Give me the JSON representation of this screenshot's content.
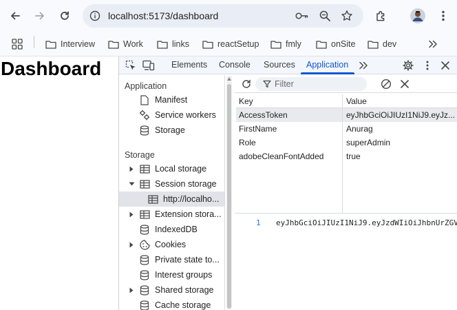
{
  "browser": {
    "url": "localhost:5173/dashboard",
    "bookmarks": [
      "Interview",
      "Work",
      "links",
      "reactSetup",
      "fmly",
      "onSite",
      "dev"
    ]
  },
  "page": {
    "heading": "Dashboard"
  },
  "devtools": {
    "tabs": [
      "Elements",
      "Console",
      "Sources",
      "Application"
    ],
    "active_tab": "Application",
    "sidebar": {
      "application_title": "Application",
      "application_items": [
        "Manifest",
        "Service workers",
        "Storage"
      ],
      "storage_title": "Storage",
      "storage_items": [
        "Local storage",
        "Session storage",
        "http://localho...",
        "Extension stora...",
        "IndexedDB",
        "Cookies",
        "Private state to...",
        "Interest groups",
        "Shared storage",
        "Cache storage"
      ]
    },
    "filter_placeholder": "Filter",
    "table": {
      "headers": [
        "Key",
        "Value"
      ],
      "rows": [
        {
          "key": "AccessToken",
          "value": "eyJhbGciOiJIUzI1NiJ9.eyJz..."
        },
        {
          "key": "FirstName",
          "value": "Anurag"
        },
        {
          "key": "Role",
          "value": "superAdmin"
        },
        {
          "key": "adobeCleanFontAdded",
          "value": "true"
        }
      ]
    },
    "preview": {
      "line_number": "1",
      "text": "eyJhbGciOiJIUzI1NiJ9.eyJzdWIiOiJhbnUrZGV"
    }
  }
}
